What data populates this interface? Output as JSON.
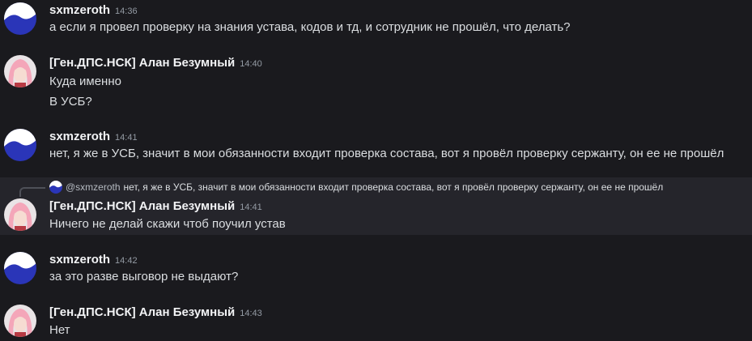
{
  "messages": [
    {
      "author": "sxmzeroth",
      "time": "14:36",
      "avatar": "wave-avatar",
      "lines": [
        "а если я провел проверку на знания устава, кодов и тд, и сотрудник не прошёл, что делать?"
      ]
    },
    {
      "author": "[Ген.ДПС.НСК] Алан Безумный",
      "time": "14:40",
      "avatar": "anime-avatar",
      "lines": [
        "Куда именно",
        "В УСБ?"
      ]
    },
    {
      "author": "sxmzeroth",
      "time": "14:41",
      "avatar": "wave-avatar",
      "lines": [
        "нет, я же в УСБ, значит в мои обязанности входит проверка состава, вот я провёл проверку сержанту, он ее не прошёл"
      ]
    },
    {
      "author": "[Ген.ДПС.НСК] Алан Безумный",
      "time": "14:41",
      "avatar": "anime-avatar",
      "reply": {
        "mention": "@sxmzeroth",
        "text": "нет, я же в УСБ, значит в мои обязанности входит проверка состава, вот я провёл проверку сержанту, он ее не прошёл"
      },
      "lines": [
        "Ничего не делай скажи чтоб поучил устав"
      ]
    },
    {
      "author": "sxmzeroth",
      "time": "14:42",
      "avatar": "wave-avatar",
      "lines": [
        "за это разве выговор не выдают?"
      ]
    },
    {
      "author": "[Ген.ДПС.НСК] Алан Безумный",
      "time": "14:43",
      "avatar": "anime-avatar",
      "lines": [
        "Нет"
      ]
    }
  ],
  "colors": {
    "background": "#1a1a1e",
    "highlight": "#25252b",
    "wave_avatar_bg": "#2a35b8",
    "anime_avatar_hair": "#f4a6b9"
  }
}
